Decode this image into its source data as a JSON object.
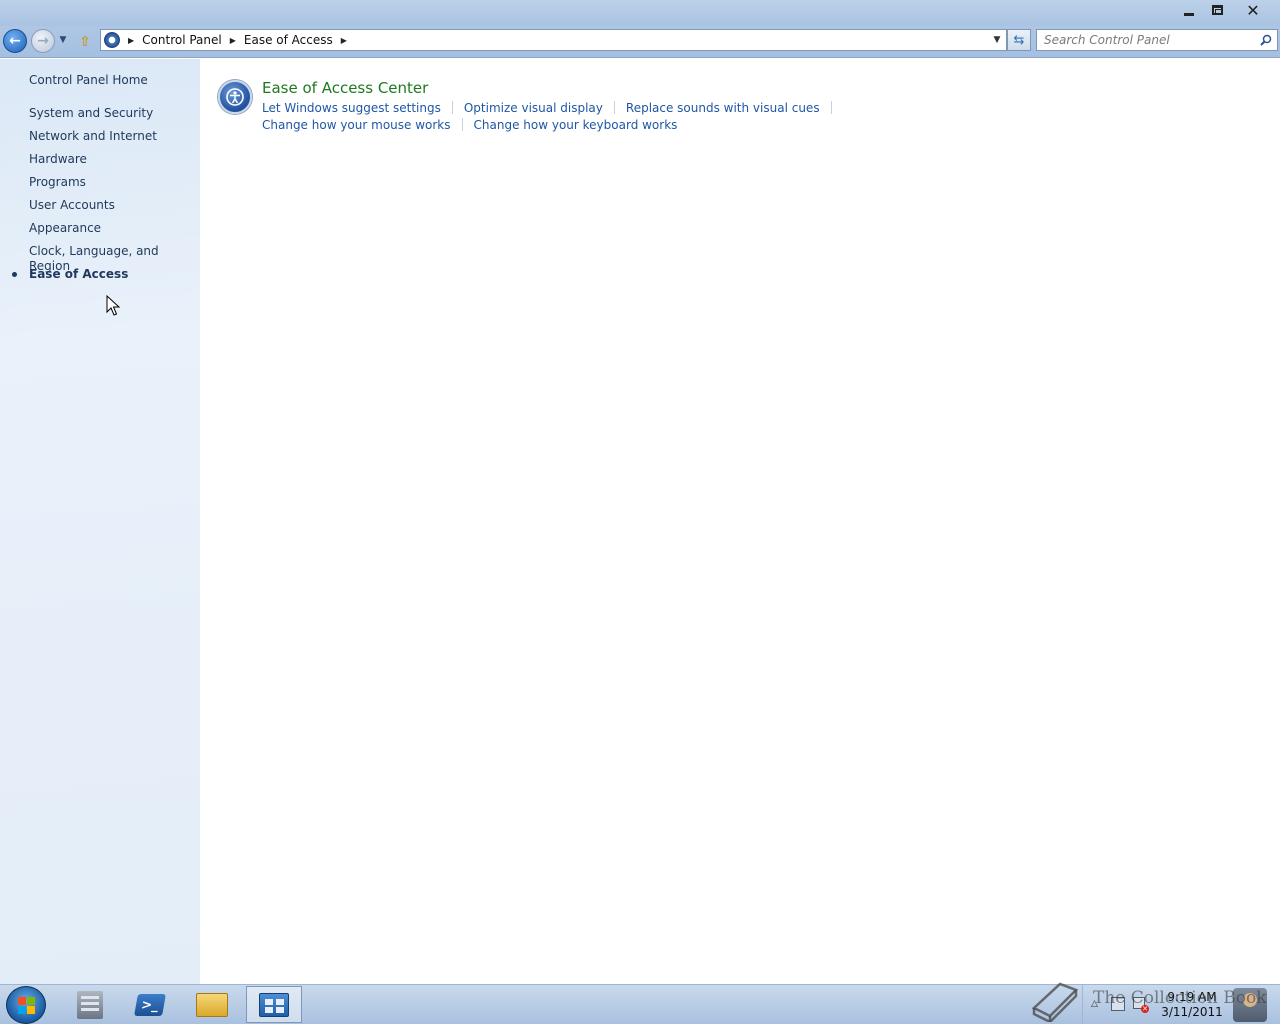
{
  "window": {
    "minimize_label": "",
    "maximize_label": "",
    "close_label": "✕"
  },
  "address": {
    "crumbs": [
      "Control Panel",
      "Ease of Access"
    ]
  },
  "search": {
    "placeholder": "Search Control Panel"
  },
  "sidebar": {
    "home": "Control Panel Home",
    "items": [
      {
        "label": "System and Security"
      },
      {
        "label": "Network and Internet"
      },
      {
        "label": "Hardware"
      },
      {
        "label": "Programs"
      },
      {
        "label": "User Accounts"
      },
      {
        "label": "Appearance"
      },
      {
        "label": "Clock, Language, and Region"
      },
      {
        "label": "Ease of Access",
        "active": true
      }
    ]
  },
  "main": {
    "category": {
      "title": "Ease of Access Center",
      "icon": "ease-of-access-icon",
      "links_row1": [
        "Let Windows suggest settings",
        "Optimize visual display",
        "Replace sounds with visual cues"
      ],
      "links_row2": [
        "Change how your mouse works",
        "Change how your keyboard works"
      ]
    }
  },
  "taskbar": {
    "apps": [
      {
        "icon": "server-manager-icon"
      },
      {
        "icon": "powershell-icon",
        "glyph": ">_"
      },
      {
        "icon": "explorer-folder-icon"
      },
      {
        "icon": "control-panel-icon",
        "active": true
      }
    ],
    "clock": {
      "time": "9:19 AM",
      "date": "3/11/2011"
    }
  },
  "watermark": {
    "text": "The Collection Book"
  },
  "colors": {
    "link": "#1f57a6",
    "category_title": "#1e7a1e",
    "sidebar_text": "#1e395b"
  }
}
